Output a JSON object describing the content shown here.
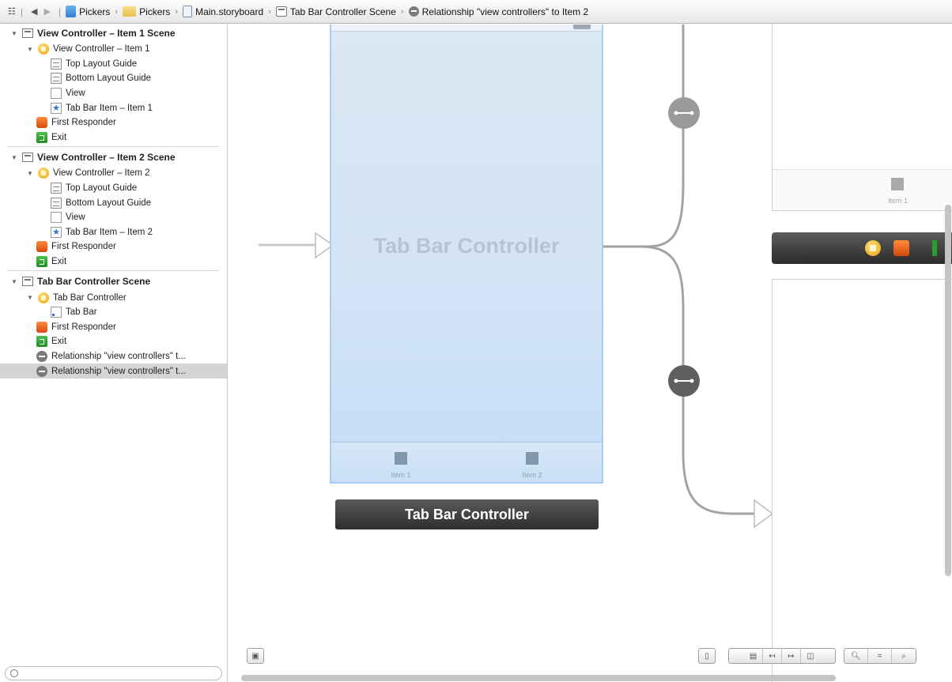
{
  "jumpbar": {
    "crumbs": [
      "Pickers",
      "Pickers",
      "Main.storyboard",
      "Tab Bar Controller Scene",
      "Relationship \"view controllers\" to Item 2"
    ]
  },
  "outline": {
    "scene1": {
      "title": "View Controller – Item 1 Scene",
      "vc": "View Controller – Item 1",
      "top_guide": "Top Layout Guide",
      "bottom_guide": "Bottom Layout Guide",
      "view": "View",
      "tab_item": "Tab Bar Item – Item 1",
      "first_responder": "First Responder",
      "exit": "Exit"
    },
    "scene2": {
      "title": "View Controller – Item 2 Scene",
      "vc": "View Controller – Item 2",
      "top_guide": "Top Layout Guide",
      "bottom_guide": "Bottom Layout Guide",
      "view": "View",
      "tab_item": "Tab Bar Item – Item 2",
      "first_responder": "First Responder",
      "exit": "Exit"
    },
    "scene3": {
      "title": "Tab Bar Controller Scene",
      "tbc": "Tab Bar Controller",
      "tab_bar": "Tab Bar",
      "first_responder": "First Responder",
      "exit": "Exit",
      "rel1": "Relationship \"view controllers\" t...",
      "rel2": "Relationship \"view controllers\" t..."
    }
  },
  "canvas": {
    "tbc_title": "Tab Bar Controller",
    "tab1": "Item 1",
    "tab2": "Item 2",
    "tbc_label": "Tab Bar Controller",
    "vc1_tab": "Item 1"
  },
  "colors": {
    "selection": "#d4d4d4",
    "tbc_fill": "#d3e4f5",
    "tbc_border": "#a9cdf0",
    "segue": "#9a9a9a"
  }
}
